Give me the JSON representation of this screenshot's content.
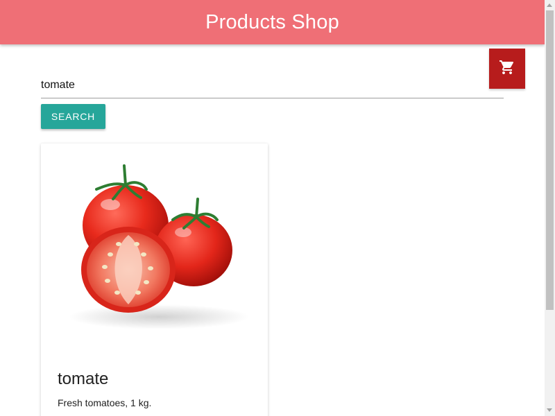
{
  "header": {
    "title": "Products Shop"
  },
  "cart": {
    "icon": "shopping-cart-icon"
  },
  "search": {
    "value": "tomate",
    "button_label": "Search"
  },
  "products": [
    {
      "name": "tomate",
      "description": "Fresh tomatoes, 1 kg.",
      "image": "tomatoes-photo"
    }
  ],
  "colors": {
    "header": "#ef6f76",
    "cart_button": "#b71c1c",
    "search_button": "#26a69a"
  }
}
